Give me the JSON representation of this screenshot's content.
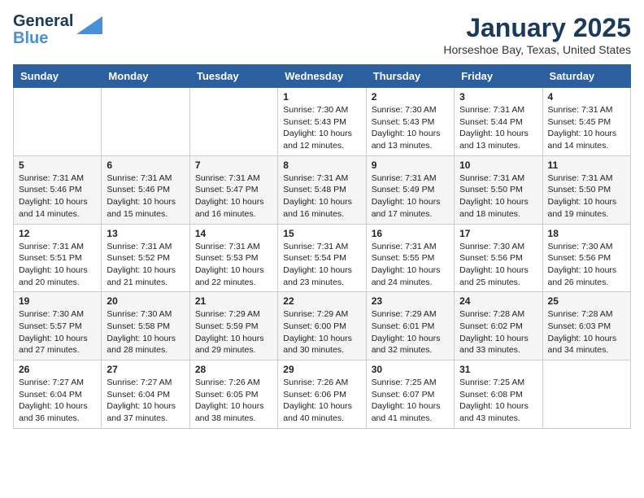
{
  "header": {
    "logo_line1": "General",
    "logo_line2": "Blue",
    "month": "January 2025",
    "location": "Horseshoe Bay, Texas, United States"
  },
  "weekdays": [
    "Sunday",
    "Monday",
    "Tuesday",
    "Wednesday",
    "Thursday",
    "Friday",
    "Saturday"
  ],
  "weeks": [
    [
      {
        "day": "",
        "info": ""
      },
      {
        "day": "",
        "info": ""
      },
      {
        "day": "",
        "info": ""
      },
      {
        "day": "1",
        "info": "Sunrise: 7:30 AM\nSunset: 5:43 PM\nDaylight: 10 hours\nand 12 minutes."
      },
      {
        "day": "2",
        "info": "Sunrise: 7:30 AM\nSunset: 5:43 PM\nDaylight: 10 hours\nand 13 minutes."
      },
      {
        "day": "3",
        "info": "Sunrise: 7:31 AM\nSunset: 5:44 PM\nDaylight: 10 hours\nand 13 minutes."
      },
      {
        "day": "4",
        "info": "Sunrise: 7:31 AM\nSunset: 5:45 PM\nDaylight: 10 hours\nand 14 minutes."
      }
    ],
    [
      {
        "day": "5",
        "info": "Sunrise: 7:31 AM\nSunset: 5:46 PM\nDaylight: 10 hours\nand 14 minutes."
      },
      {
        "day": "6",
        "info": "Sunrise: 7:31 AM\nSunset: 5:46 PM\nDaylight: 10 hours\nand 15 minutes."
      },
      {
        "day": "7",
        "info": "Sunrise: 7:31 AM\nSunset: 5:47 PM\nDaylight: 10 hours\nand 16 minutes."
      },
      {
        "day": "8",
        "info": "Sunrise: 7:31 AM\nSunset: 5:48 PM\nDaylight: 10 hours\nand 16 minutes."
      },
      {
        "day": "9",
        "info": "Sunrise: 7:31 AM\nSunset: 5:49 PM\nDaylight: 10 hours\nand 17 minutes."
      },
      {
        "day": "10",
        "info": "Sunrise: 7:31 AM\nSunset: 5:50 PM\nDaylight: 10 hours\nand 18 minutes."
      },
      {
        "day": "11",
        "info": "Sunrise: 7:31 AM\nSunset: 5:50 PM\nDaylight: 10 hours\nand 19 minutes."
      }
    ],
    [
      {
        "day": "12",
        "info": "Sunrise: 7:31 AM\nSunset: 5:51 PM\nDaylight: 10 hours\nand 20 minutes."
      },
      {
        "day": "13",
        "info": "Sunrise: 7:31 AM\nSunset: 5:52 PM\nDaylight: 10 hours\nand 21 minutes."
      },
      {
        "day": "14",
        "info": "Sunrise: 7:31 AM\nSunset: 5:53 PM\nDaylight: 10 hours\nand 22 minutes."
      },
      {
        "day": "15",
        "info": "Sunrise: 7:31 AM\nSunset: 5:54 PM\nDaylight: 10 hours\nand 23 minutes."
      },
      {
        "day": "16",
        "info": "Sunrise: 7:31 AM\nSunset: 5:55 PM\nDaylight: 10 hours\nand 24 minutes."
      },
      {
        "day": "17",
        "info": "Sunrise: 7:30 AM\nSunset: 5:56 PM\nDaylight: 10 hours\nand 25 minutes."
      },
      {
        "day": "18",
        "info": "Sunrise: 7:30 AM\nSunset: 5:56 PM\nDaylight: 10 hours\nand 26 minutes."
      }
    ],
    [
      {
        "day": "19",
        "info": "Sunrise: 7:30 AM\nSunset: 5:57 PM\nDaylight: 10 hours\nand 27 minutes."
      },
      {
        "day": "20",
        "info": "Sunrise: 7:30 AM\nSunset: 5:58 PM\nDaylight: 10 hours\nand 28 minutes."
      },
      {
        "day": "21",
        "info": "Sunrise: 7:29 AM\nSunset: 5:59 PM\nDaylight: 10 hours\nand 29 minutes."
      },
      {
        "day": "22",
        "info": "Sunrise: 7:29 AM\nSunset: 6:00 PM\nDaylight: 10 hours\nand 30 minutes."
      },
      {
        "day": "23",
        "info": "Sunrise: 7:29 AM\nSunset: 6:01 PM\nDaylight: 10 hours\nand 32 minutes."
      },
      {
        "day": "24",
        "info": "Sunrise: 7:28 AM\nSunset: 6:02 PM\nDaylight: 10 hours\nand 33 minutes."
      },
      {
        "day": "25",
        "info": "Sunrise: 7:28 AM\nSunset: 6:03 PM\nDaylight: 10 hours\nand 34 minutes."
      }
    ],
    [
      {
        "day": "26",
        "info": "Sunrise: 7:27 AM\nSunset: 6:04 PM\nDaylight: 10 hours\nand 36 minutes."
      },
      {
        "day": "27",
        "info": "Sunrise: 7:27 AM\nSunset: 6:04 PM\nDaylight: 10 hours\nand 37 minutes."
      },
      {
        "day": "28",
        "info": "Sunrise: 7:26 AM\nSunset: 6:05 PM\nDaylight: 10 hours\nand 38 minutes."
      },
      {
        "day": "29",
        "info": "Sunrise: 7:26 AM\nSunset: 6:06 PM\nDaylight: 10 hours\nand 40 minutes."
      },
      {
        "day": "30",
        "info": "Sunrise: 7:25 AM\nSunset: 6:07 PM\nDaylight: 10 hours\nand 41 minutes."
      },
      {
        "day": "31",
        "info": "Sunrise: 7:25 AM\nSunset: 6:08 PM\nDaylight: 10 hours\nand 43 minutes."
      },
      {
        "day": "",
        "info": ""
      }
    ]
  ]
}
